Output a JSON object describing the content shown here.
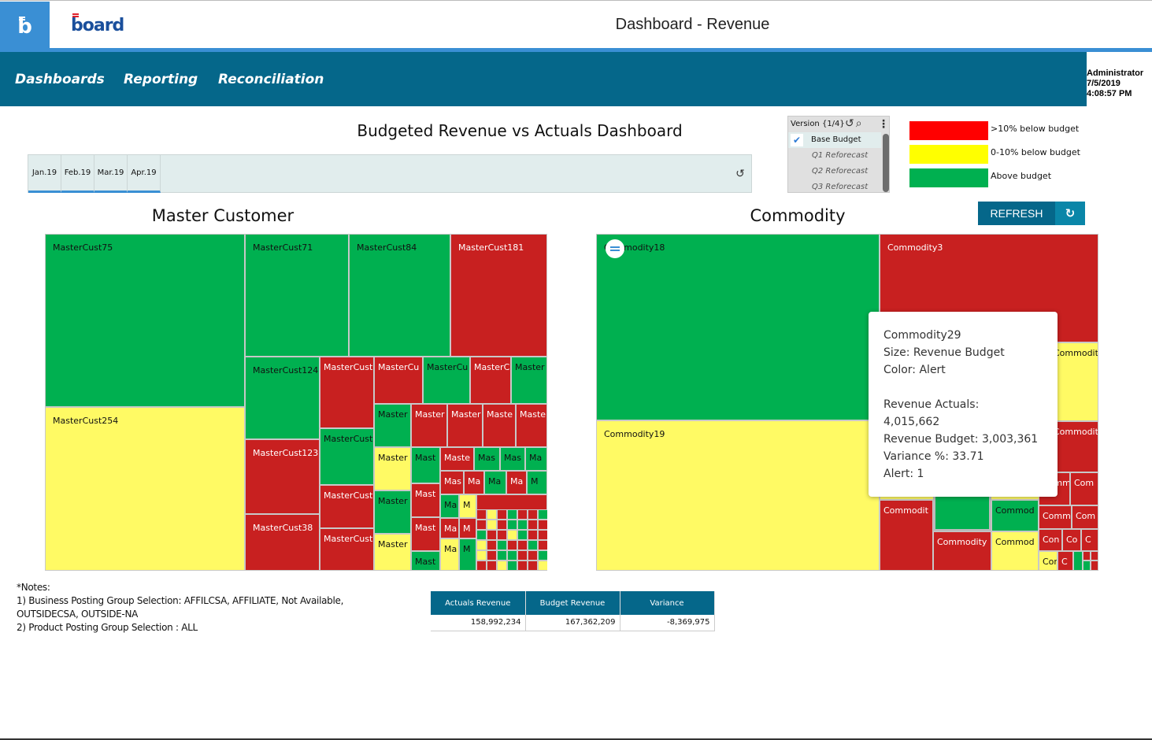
{
  "header": {
    "logo_letter": "b",
    "brand_name": "board",
    "title": "Dashboard - Revenue"
  },
  "nav": {
    "items": [
      {
        "label": "Dashboards"
      },
      {
        "label": "Reporting"
      },
      {
        "label": "Reconciliation"
      }
    ]
  },
  "user": {
    "name": "Administrator",
    "date": "7/5/2019",
    "time": "4:08:57 PM"
  },
  "dashboard": {
    "title": "Budgeted Revenue vs Actuals Dashboard"
  },
  "periods": {
    "tabs": [
      {
        "label": "Jan.19"
      },
      {
        "label": "Feb.19"
      },
      {
        "label": "Mar.19"
      },
      {
        "label": "Apr.19"
      }
    ],
    "reset_icon": "reset-icon"
  },
  "version": {
    "header": "Version {1/4}",
    "selected": "Base Budget",
    "options": [
      "Q1 Reforecast",
      "Q2 Reforecast",
      "Q3 Reforecast"
    ],
    "icons": {
      "reset": "↺",
      "search": "⌕",
      "menu": "⋮"
    }
  },
  "legend": {
    "items": [
      {
        "label": ">10% below budget",
        "color": "#ff0000"
      },
      {
        "label": "0-10% below budget",
        "color": "#ffff00"
      },
      {
        "label": "Above budget",
        "color": "#00b050"
      }
    ]
  },
  "refresh": {
    "label": "REFRESH",
    "icon": "↻"
  },
  "colors": {
    "green": "#00b050",
    "red": "#c82020",
    "yellow": "#fffa64",
    "nav": "#05678a",
    "accent": "#3a8fd4"
  },
  "chart_data": [
    {
      "type": "treemap",
      "title": "Master Customer",
      "size_measure": "Revenue Budget",
      "color_measure": "Alert",
      "labeled_cells": [
        {
          "label": "MasterCust75",
          "alert": "green"
        },
        {
          "label": "MasterCust254",
          "alert": "yellow"
        },
        {
          "label": "MasterCust71",
          "alert": "green"
        },
        {
          "label": "MasterCust84",
          "alert": "green"
        },
        {
          "label": "MasterCust181",
          "alert": "red"
        },
        {
          "label": "MasterCust124",
          "alert": "green"
        },
        {
          "label": "MasterCust123",
          "alert": "red"
        },
        {
          "label": "MasterCust38",
          "alert": "red"
        },
        {
          "label": "MasterCust",
          "alert": "red"
        },
        {
          "label": "MasterCust",
          "alert": "green"
        },
        {
          "label": "MasterCust",
          "alert": "red"
        },
        {
          "label": "MasterCust",
          "alert": "red"
        },
        {
          "label": "MasterCu",
          "alert": "red"
        },
        {
          "label": "MasterCu",
          "alert": "green"
        },
        {
          "label": "MasterC",
          "alert": "red"
        },
        {
          "label": "Master",
          "alert": "green"
        },
        {
          "label": "Master",
          "alert": "green"
        },
        {
          "label": "Master",
          "alert": "yellow"
        },
        {
          "label": "Master",
          "alert": "green"
        },
        {
          "label": "Master",
          "alert": "yellow"
        }
      ]
    },
    {
      "type": "treemap",
      "title": "Commodity",
      "size_measure": "Revenue Budget",
      "color_measure": "Alert",
      "labeled_cells": [
        {
          "label": "Commodity18",
          "alert": "green"
        },
        {
          "label": "Commodity3",
          "alert": "red"
        },
        {
          "label": "Commodity19",
          "alert": "yellow"
        },
        {
          "label": "Commodity29",
          "alert": "green"
        },
        {
          "label": "Commodit",
          "alert": "yellow"
        },
        {
          "label": "Commodit",
          "alert": "red"
        },
        {
          "label": "Commodit",
          "alert": "red"
        },
        {
          "label": "Commodity",
          "alert": "red"
        },
        {
          "label": "Commod",
          "alert": "green"
        },
        {
          "label": "Commod",
          "alert": "yellow"
        }
      ]
    }
  ],
  "tooltip": {
    "name": "Commodity29",
    "size": "Size: Revenue Budget",
    "color": "Color: Alert",
    "actuals_label": "Revenue Actuals:",
    "actuals_value": "4,015,662",
    "budget": "Revenue Budget: 3,003,361",
    "variance": "Variance %: 33.71",
    "alert": "Alert: 1"
  },
  "notes": {
    "heading": "*Notes:",
    "line1": "1) Business Posting Group Selection: AFFILCSA, AFFILIATE, Not Available, OUTSIDECSA, OUTSIDE-NA",
    "line2": "2) Product Posting Group Selection : ALL"
  },
  "summary": {
    "headers": [
      "Actuals Revenue",
      "Budget Revenue",
      "Variance"
    ],
    "values": [
      "158,992,234",
      "167,362,209",
      "-8,369,975"
    ]
  }
}
